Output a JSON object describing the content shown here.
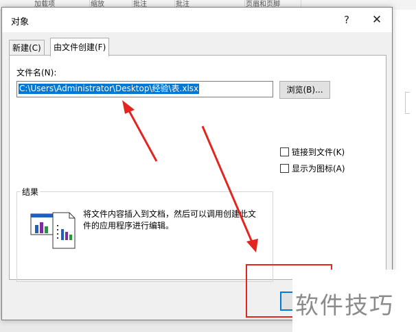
{
  "background": {
    "ribbon_items": [
      "加载项",
      "缩放",
      "批注",
      "批注",
      "页眉和页脚"
    ]
  },
  "dialog": {
    "title": "对象",
    "help_symbol": "?",
    "close_symbol": "✕",
    "tabs": [
      {
        "label": "新建(C)",
        "active": false
      },
      {
        "label": "由文件创建(F)",
        "active": true
      }
    ],
    "filename_label": "文件名(N):",
    "filename_value": "C:\\Users\\Administrator\\Desktop\\经验\\表.xlsx",
    "browse_label": "浏览(B)...",
    "link_to_file_label": "链接到文件(K)",
    "link_to_file_checked": false,
    "display_as_icon_label": "显示为图标(A)",
    "display_as_icon_checked": false,
    "result_title": "结果",
    "result_text": "将文件内容插入到文档，然后可以调用创建此文件的应用程序进行编辑。"
  },
  "annotations": {
    "arrow_color": "#e2261f",
    "highlight_color": "#e2261f"
  },
  "watermark": "软件技巧",
  "colors": {
    "selection": "#0078d7",
    "dialog_bg": "#f0f0f0"
  },
  "icons": [
    "help-icon",
    "close-icon",
    "document-chart-icon"
  ]
}
